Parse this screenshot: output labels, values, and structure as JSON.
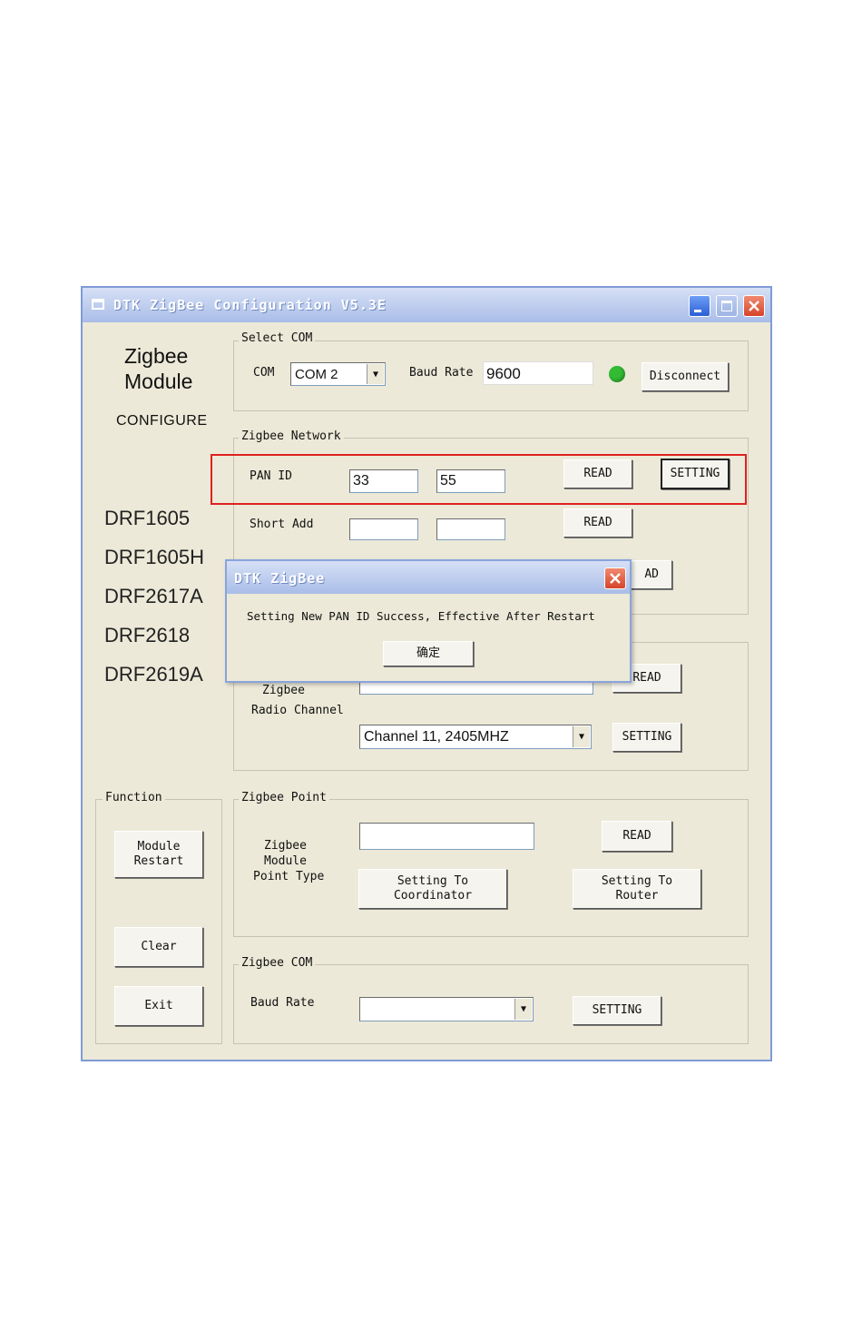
{
  "window": {
    "title": "DTK ZigBee Configuration V5.3E"
  },
  "brand": {
    "line1": "Zigbee",
    "line2": "Module",
    "sub": "CONFIGURE"
  },
  "models": [
    "DRF1605",
    "DRF1605H",
    "DRF2617A",
    "DRF2618",
    "DRF2619A"
  ],
  "select_com": {
    "legend": "Select COM",
    "com_label": "COM",
    "com_value": "COM 2",
    "baud_label": "Baud Rate",
    "baud_value": "9600",
    "status_color": "#33bb33",
    "disconnect_label": "Disconnect"
  },
  "network": {
    "legend": "Zigbee Network",
    "pan_label": "PAN ID",
    "pan_value_1": "33",
    "pan_value_2": "55",
    "pan_read_label": "READ",
    "pan_setting_label": "SETTING",
    "short_label": "Short Add",
    "short_read_label": "READ",
    "third_read_label": "AD"
  },
  "radio": {
    "line1": "Zigbee",
    "line2": "Radio Channel",
    "channel_value": "Channel 11, 2405MHZ",
    "read_label": "READ",
    "setting_label": "SETTING"
  },
  "function": {
    "legend": "Function",
    "restart_line1": "Module",
    "restart_line2": "Restart",
    "clear_label": "Clear",
    "exit_label": "Exit"
  },
  "point": {
    "legend": "Zigbee Point",
    "line1": "Zigbee",
    "line2": "Module",
    "line3": "Point Type",
    "read_label": "READ",
    "coord_line1": "Setting To",
    "coord_line2": "Coordinator",
    "router_line1": "Setting To",
    "router_line2": "Router"
  },
  "zcom": {
    "legend": "Zigbee COM",
    "baud_label": "Baud Rate",
    "setting_label": "SETTING"
  },
  "dialog": {
    "title": "DTK ZigBee",
    "message": "Setting New PAN ID Success, Effective After Restart",
    "ok_label": "确定"
  },
  "colors": {
    "highlight": "#e02020",
    "title_gradient_top": "#d6e0f5",
    "title_gradient_bottom": "#a9bde8"
  }
}
